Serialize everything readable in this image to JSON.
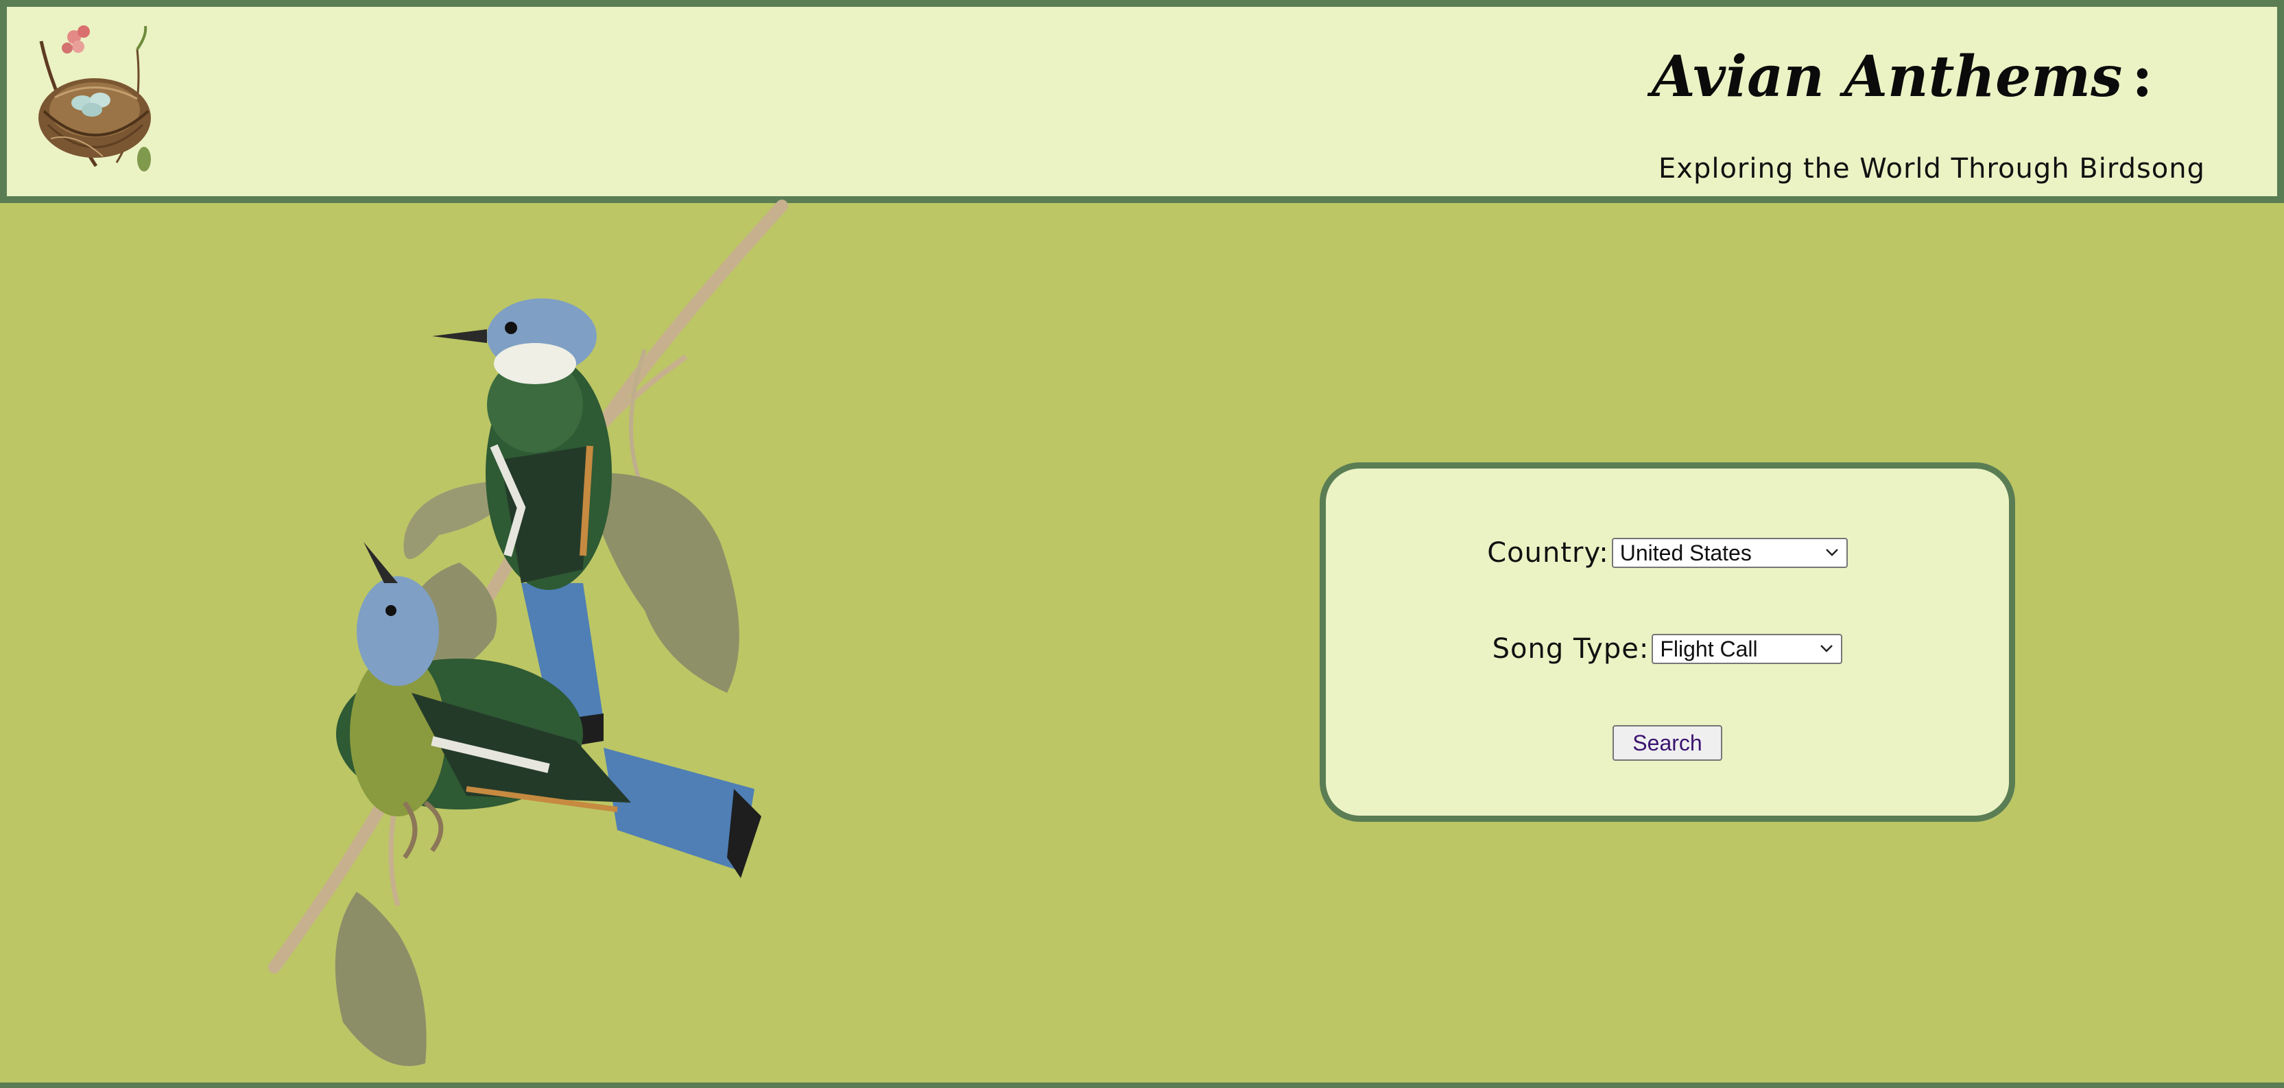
{
  "header": {
    "title": "Avian Anthems",
    "title_suffix": ":",
    "subtitle": "Exploring the World Through Birdsong",
    "logo_icon": "bird-nest-icon"
  },
  "illustration": {
    "icon": "two-birds-on-branch-icon"
  },
  "search_form": {
    "country_label": "Country:",
    "country_value": "United States",
    "song_type_label": "Song Type:",
    "song_type_value": "Flight Call",
    "search_button_label": "Search",
    "select_icon": "chevron-down-icon"
  },
  "colors": {
    "page_background": "#bcc665",
    "header_background": "#ebf2c4",
    "panel_background": "#ebf2c4",
    "border_accent": "#5a7d54",
    "button_text": "#3b1470"
  }
}
